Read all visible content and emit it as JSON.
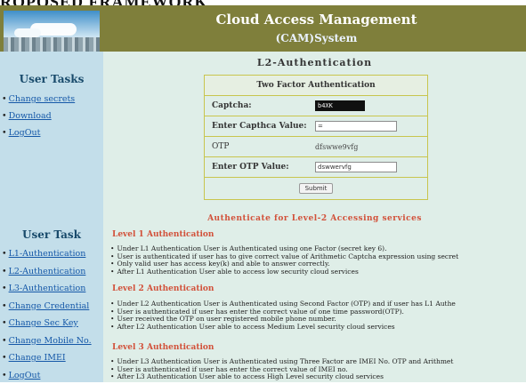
{
  "page": {
    "top_caption": "ROPOSED FRAMEWORK"
  },
  "header": {
    "title_line1": "Cloud Access Management",
    "title_line2": "(CAM)System"
  },
  "sidebar": {
    "group1_title": "User Tasks",
    "group1_items": [
      "Change secrets",
      "Download",
      "LogOut"
    ],
    "group2_title": "User Task",
    "group2_items": [
      "L1-Authentication",
      "L2-Authentication",
      "L3-Authentication",
      "Change Credential",
      "Change Sec Key",
      "Change Mobile No.",
      "Change IMEI",
      "LogOut"
    ]
  },
  "main": {
    "heading": "L2-Authentication",
    "form": {
      "title": "Two Factor Authentication",
      "captcha_label": "Captcha:",
      "captcha_value": "b4XK",
      "captcha_input_label": "Enter Capthca Value:",
      "captcha_input_value": "=",
      "otp_label": "OTP",
      "otp_value": "dfswwe9vfg",
      "otp_input_label": "Enter OTP Value:",
      "otp_input_value": "dswwervfg",
      "submit_label": "Submit"
    },
    "levels_title": "Authenticate for Level-2 Accessing services",
    "levels": [
      {
        "heading": "Level 1 Authentication",
        "lines": [
          "Under L1 Authentication User is Authenticated using one Factor (secret key 6).",
          "User is authenticated if user has to give correct value of Arithmetic Captcha expression using secret",
          "Only valid user has access key(k) and able to answer correctly.",
          "After L1 Authentication User able to access low security cloud services"
        ]
      },
      {
        "heading": "Level 2 Authentication",
        "lines": [
          "Under L2 Authentication User is Authenticated using Second Factor (OTP) and if user has L1 Authe",
          "User is authenticated if user has enter the correct value of one time password(OTP).",
          "User received the OTP on user registered mobile phone number.",
          "After L2 Authentication User able to access Medium Level security cloud services"
        ]
      },
      {
        "heading": "Level 3 Authentication",
        "lines": [
          "Under L3 Authentication User is Authenticated using Three Factor are IMEI No. OTP and Arithmet",
          "User is authenticated if user has enter the correct value of IMEI no.",
          "After L3 Authentication User able to access High Level security cloud services"
        ]
      }
    ]
  }
}
